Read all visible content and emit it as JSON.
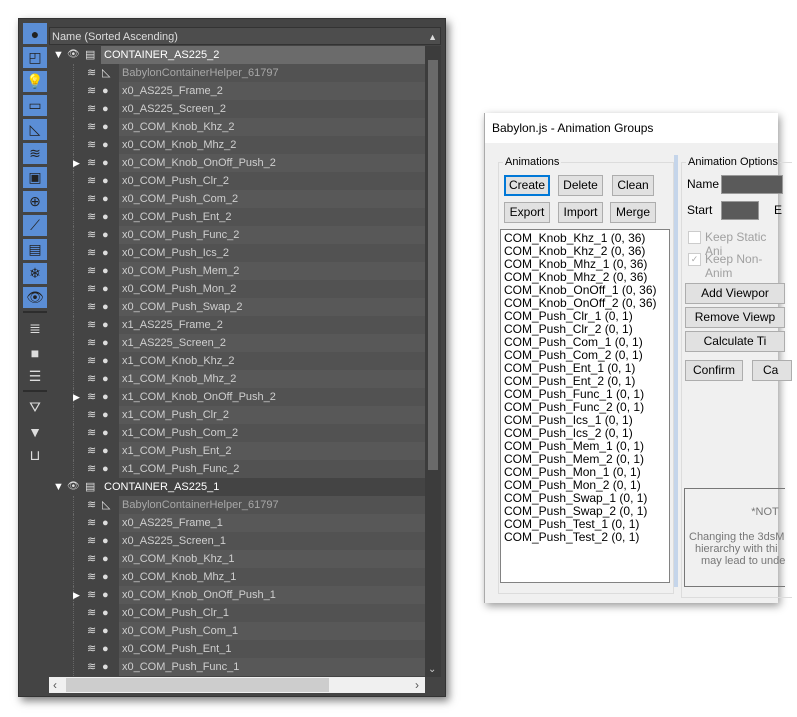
{
  "scene_explorer": {
    "header": "Name (Sorted Ascending)",
    "toolbar_icons": [
      "circle-icon",
      "shapes-icon",
      "lightbulb-icon",
      "camera-icon",
      "set-square-icon",
      "space-warp-icon",
      "group-icon",
      "xref-icon",
      "bone-icon",
      "container-icon",
      "snowflake-icon",
      "eye-icon",
      "document-icon",
      "square-icon",
      "list-document-icon",
      "filter-gear-icon",
      "filter-icon",
      "layer-icon"
    ],
    "groups": [
      {
        "name": "CONTAINER_AS225_2",
        "selected": true,
        "children": [
          {
            "name": "BabylonContainerHelper_61797",
            "helper": true
          },
          {
            "name": "x0_AS225_Frame_2"
          },
          {
            "name": "x0_AS225_Screen_2"
          },
          {
            "name": "x0_COM_Knob_Khz_2"
          },
          {
            "name": "x0_COM_Knob_Mhz_2"
          },
          {
            "name": "x0_COM_Knob_OnOff_Push_2",
            "expandable": true
          },
          {
            "name": "x0_COM_Push_Clr_2"
          },
          {
            "name": "x0_COM_Push_Com_2"
          },
          {
            "name": "x0_COM_Push_Ent_2"
          },
          {
            "name": "x0_COM_Push_Func_2"
          },
          {
            "name": "x0_COM_Push_Ics_2"
          },
          {
            "name": "x0_COM_Push_Mem_2"
          },
          {
            "name": "x0_COM_Push_Mon_2"
          },
          {
            "name": "x0_COM_Push_Swap_2"
          },
          {
            "name": "x1_AS225_Frame_2"
          },
          {
            "name": "x1_AS225_Screen_2"
          },
          {
            "name": "x1_COM_Knob_Khz_2"
          },
          {
            "name": "x1_COM_Knob_Mhz_2"
          },
          {
            "name": "x1_COM_Knob_OnOff_Push_2",
            "expandable": true
          },
          {
            "name": "x1_COM_Push_Clr_2"
          },
          {
            "name": "x1_COM_Push_Com_2"
          },
          {
            "name": "x1_COM_Push_Ent_2"
          },
          {
            "name": "x1_COM_Push_Func_2"
          }
        ]
      },
      {
        "name": "CONTAINER_AS225_1",
        "selected": false,
        "children": [
          {
            "name": "BabylonContainerHelper_61797",
            "helper": true
          },
          {
            "name": "x0_AS225_Frame_1"
          },
          {
            "name": "x0_AS225_Screen_1"
          },
          {
            "name": "x0_COM_Knob_Khz_1"
          },
          {
            "name": "x0_COM_Knob_Mhz_1"
          },
          {
            "name": "x0_COM_Knob_OnOff_Push_1",
            "expandable": true
          },
          {
            "name": "x0_COM_Push_Clr_1"
          },
          {
            "name": "x0_COM_Push_Com_1"
          },
          {
            "name": "x0_COM_Push_Ent_1"
          },
          {
            "name": "x0_COM_Push_Func_1"
          }
        ]
      }
    ]
  },
  "dialog": {
    "title": "Babylon.js - Animation Groups",
    "animations_legend": "Animations",
    "buttons": {
      "create": "Create",
      "delete": "Delete",
      "clean": "Clean",
      "export": "Export",
      "import": "Import",
      "merge": "Merge"
    },
    "animations": [
      "COM_Knob_Khz_1 (0, 36)",
      "COM_Knob_Khz_2 (0, 36)",
      "COM_Knob_Mhz_1 (0, 36)",
      "COM_Knob_Mhz_2 (0, 36)",
      "COM_Knob_OnOff_1 (0, 36)",
      "COM_Knob_OnOff_2 (0, 36)",
      "COM_Push_Clr_1 (0, 1)",
      "COM_Push_Clr_2 (0, 1)",
      "COM_Push_Com_1 (0, 1)",
      "COM_Push_Com_2 (0, 1)",
      "COM_Push_Ent_1 (0, 1)",
      "COM_Push_Ent_2 (0, 1)",
      "COM_Push_Func_1 (0, 1)",
      "COM_Push_Func_2 (0, 1)",
      "COM_Push_Ics_1 (0, 1)",
      "COM_Push_Ics_2 (0, 1)",
      "COM_Push_Mem_1 (0, 1)",
      "COM_Push_Mem_2 (0, 1)",
      "COM_Push_Mon_1 (0, 1)",
      "COM_Push_Mon_2 (0, 1)",
      "COM_Push_Swap_1 (0, 1)",
      "COM_Push_Swap_2 (0, 1)",
      "COM_Push_Test_1 (0, 1)",
      "COM_Push_Test_2 (0, 1)"
    ],
    "options": {
      "legend": "Animation Options",
      "name_label": "Name",
      "start_label": "Start",
      "end_label_partial": "E",
      "keep_static": "Keep Static Ani",
      "keep_static_checked": false,
      "keep_non_anim": "Keep Non-Anim",
      "keep_non_anim_checked": true,
      "add_viewport": "Add Viewpor",
      "remove_viewport": "Remove Viewp",
      "calculate": "Calculate Ti",
      "confirm": "Confirm",
      "cancel": "Ca",
      "note_title": "*NOT",
      "note_lines": [
        "Changing the 3dsM",
        "hierarchy with thi",
        "may lead to unde"
      ]
    }
  }
}
